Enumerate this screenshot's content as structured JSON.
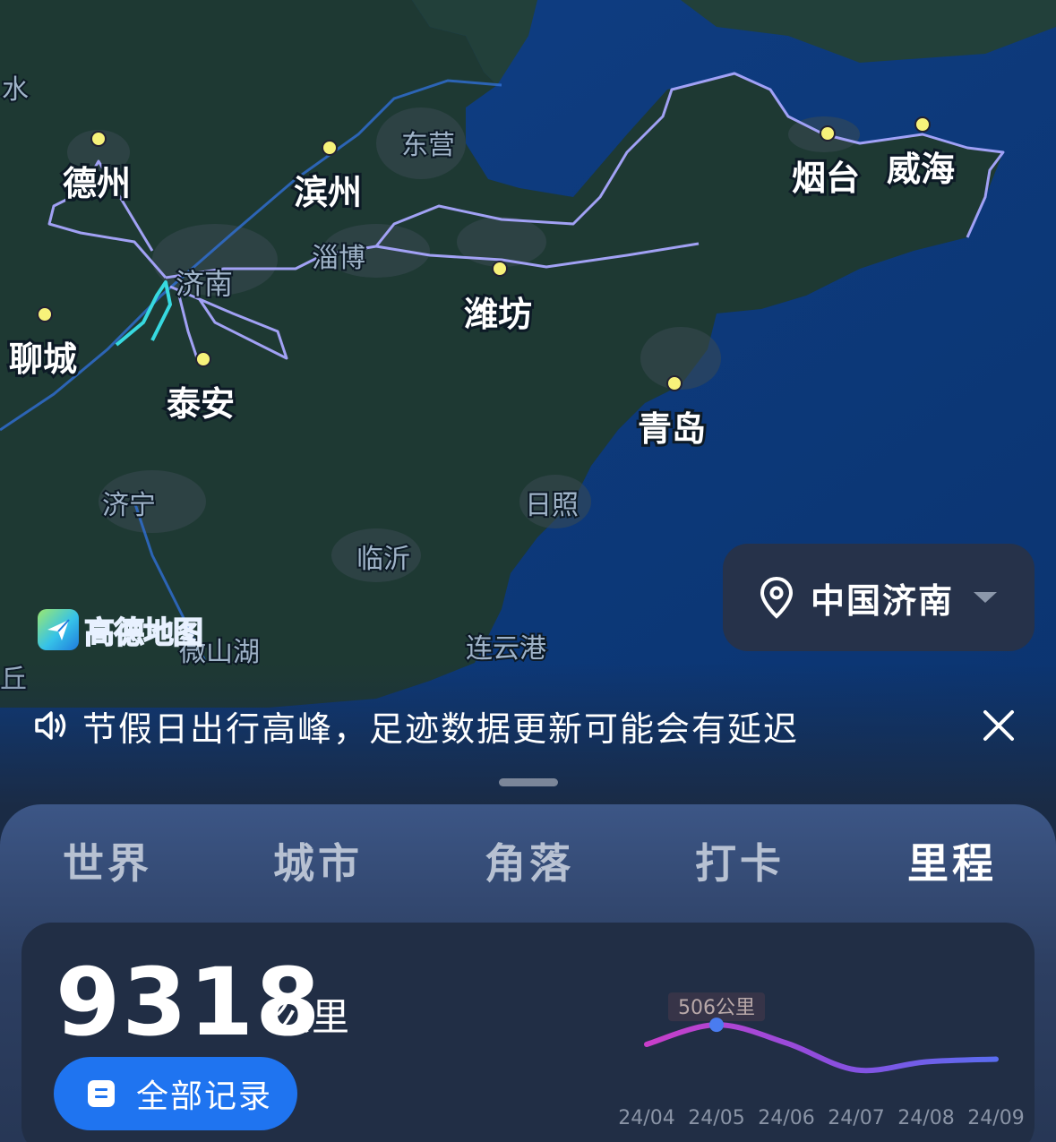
{
  "map": {
    "major_cities": [
      {
        "name": "德州",
        "size": "major"
      },
      {
        "name": "滨州",
        "size": "major"
      },
      {
        "name": "聊城",
        "size": "major"
      },
      {
        "name": "泰安",
        "size": "major"
      },
      {
        "name": "潍坊",
        "size": "major"
      },
      {
        "name": "青岛",
        "size": "major"
      },
      {
        "name": "烟台",
        "size": "major"
      },
      {
        "name": "威海",
        "size": "major"
      }
    ],
    "minor_labels": [
      "水",
      "东营",
      "淄博",
      "济南",
      "济宁",
      "日照",
      "临沂",
      "连云港",
      "微山湖",
      "丘"
    ],
    "colors": {
      "land": "#1f3a34",
      "sea": "#0d3b7a",
      "track": "#a9a7ff",
      "recent_track": "#37d9e0",
      "city_dot": "#f7f27a",
      "river": "#2f6fd6"
    }
  },
  "brand": {
    "logo_text": "高德地图",
    "logo_icon": "amap-paper-plane-icon"
  },
  "location": {
    "text": "中国济南",
    "icon": "location-pin-icon",
    "dropdown_icon": "caret-down-icon"
  },
  "notice": {
    "text": "节假日出行高峰，足迹数据更新可能会有延迟",
    "icon": "speaker-icon",
    "close_icon": "close-icon"
  },
  "tabs": [
    {
      "label": "世界",
      "active": false
    },
    {
      "label": "城市",
      "active": false
    },
    {
      "label": "角落",
      "active": false
    },
    {
      "label": "打卡",
      "active": false
    },
    {
      "label": "里程",
      "active": true
    }
  ],
  "summary": {
    "total": "9318",
    "unit": "公里",
    "button_label": "全部记录",
    "button_icon": "document-icon"
  },
  "chart_data": {
    "type": "line",
    "title": "",
    "xlabel": "",
    "ylabel": "",
    "categories": [
      "24/04",
      "24/05",
      "24/06",
      "24/07",
      "24/08",
      "24/09"
    ],
    "series": [
      {
        "values": [
          360,
          506,
          370,
          170,
          230,
          250
        ]
      }
    ],
    "highlight": {
      "index": 1,
      "label": "506公里"
    },
    "ylim": [
      0,
      600
    ],
    "grid": false,
    "legend": "none",
    "colors": {
      "start": "#c93ec9",
      "end": "#5a6cf0",
      "highlight_dot": "#4a7cf0"
    }
  }
}
